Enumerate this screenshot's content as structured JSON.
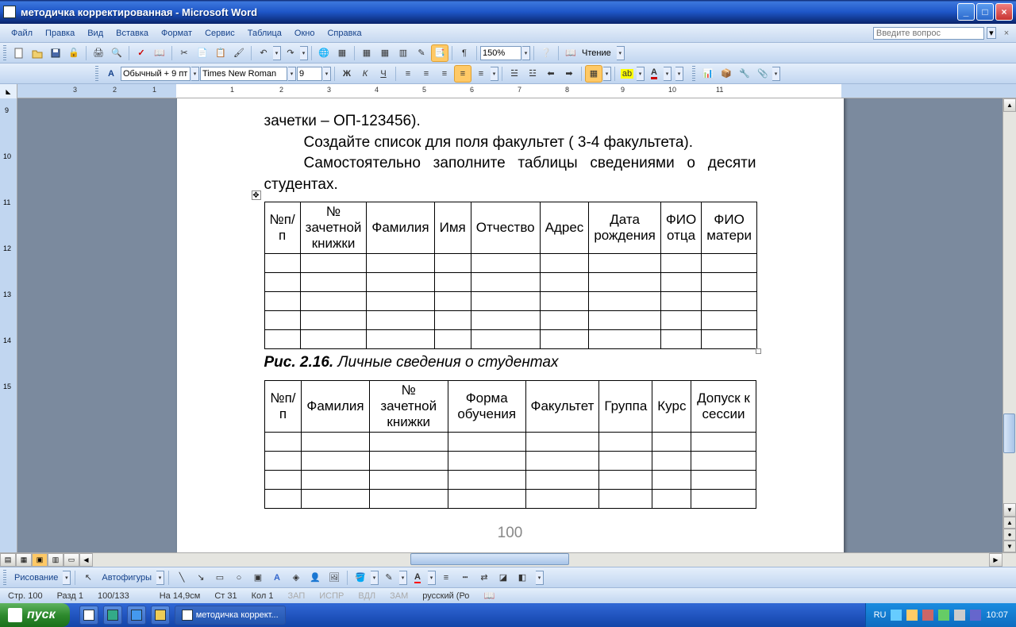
{
  "window": {
    "title": "методичка корректированная - Microsoft Word"
  },
  "menu": {
    "file": "Файл",
    "edit": "Правка",
    "view": "Вид",
    "insert": "Вставка",
    "format": "Формат",
    "service": "Сервис",
    "table": "Таблица",
    "window": "Окно",
    "help": "Справка"
  },
  "help_placeholder": "Введите вопрос",
  "format_toolbar": {
    "style": "Обычный + 9 пт",
    "font": "Times New Roman",
    "size": "9",
    "reading": "Чтение"
  },
  "zoom": "150%",
  "drawing": {
    "label": "Рисование",
    "autoshapes": "Автофигуры"
  },
  "ruler_marks": [
    "3",
    "2",
    "1",
    "1",
    "2",
    "3",
    "4",
    "5",
    "6",
    "7",
    "8",
    "9",
    "10",
    "11"
  ],
  "doc": {
    "line1": "зачетки – ОП-123456).",
    "line2": "Создайте список для поля факультет ( 3-4 факультета).",
    "line3": "Самостоятельно заполните таблицы сведениями о десяти студентах.",
    "table1_headers": [
      "№п/п",
      "№ зачетной книжки",
      "Фамилия",
      "Имя",
      "Отчество",
      "Адрес",
      "Дата рождения",
      "ФИО отца",
      "ФИО матери"
    ],
    "caption_num": "Рис. 2.16.",
    "caption_text": " Личные сведения о студентах",
    "table2_headers": [
      "№п/п",
      "Фамилия",
      "№ зачетной книжки",
      "Форма обучения",
      "Факультет",
      "Группа",
      "Курс",
      "Допуск к сессии"
    ],
    "page_number": "100"
  },
  "statusbar": {
    "page": "Стр. 100",
    "section": "Разд 1",
    "pages": "100/133",
    "at": "На 14,9см",
    "line": "Ст 31",
    "col": "Кол 1",
    "zap": "ЗАП",
    "ispr": "ИСПР",
    "vdl": "ВДЛ",
    "zam": "ЗАМ",
    "lang": "русский (Ро"
  },
  "taskbar": {
    "start": "пуск",
    "task1": "методичка коррект...",
    "lang": "RU",
    "time": "10:07"
  }
}
